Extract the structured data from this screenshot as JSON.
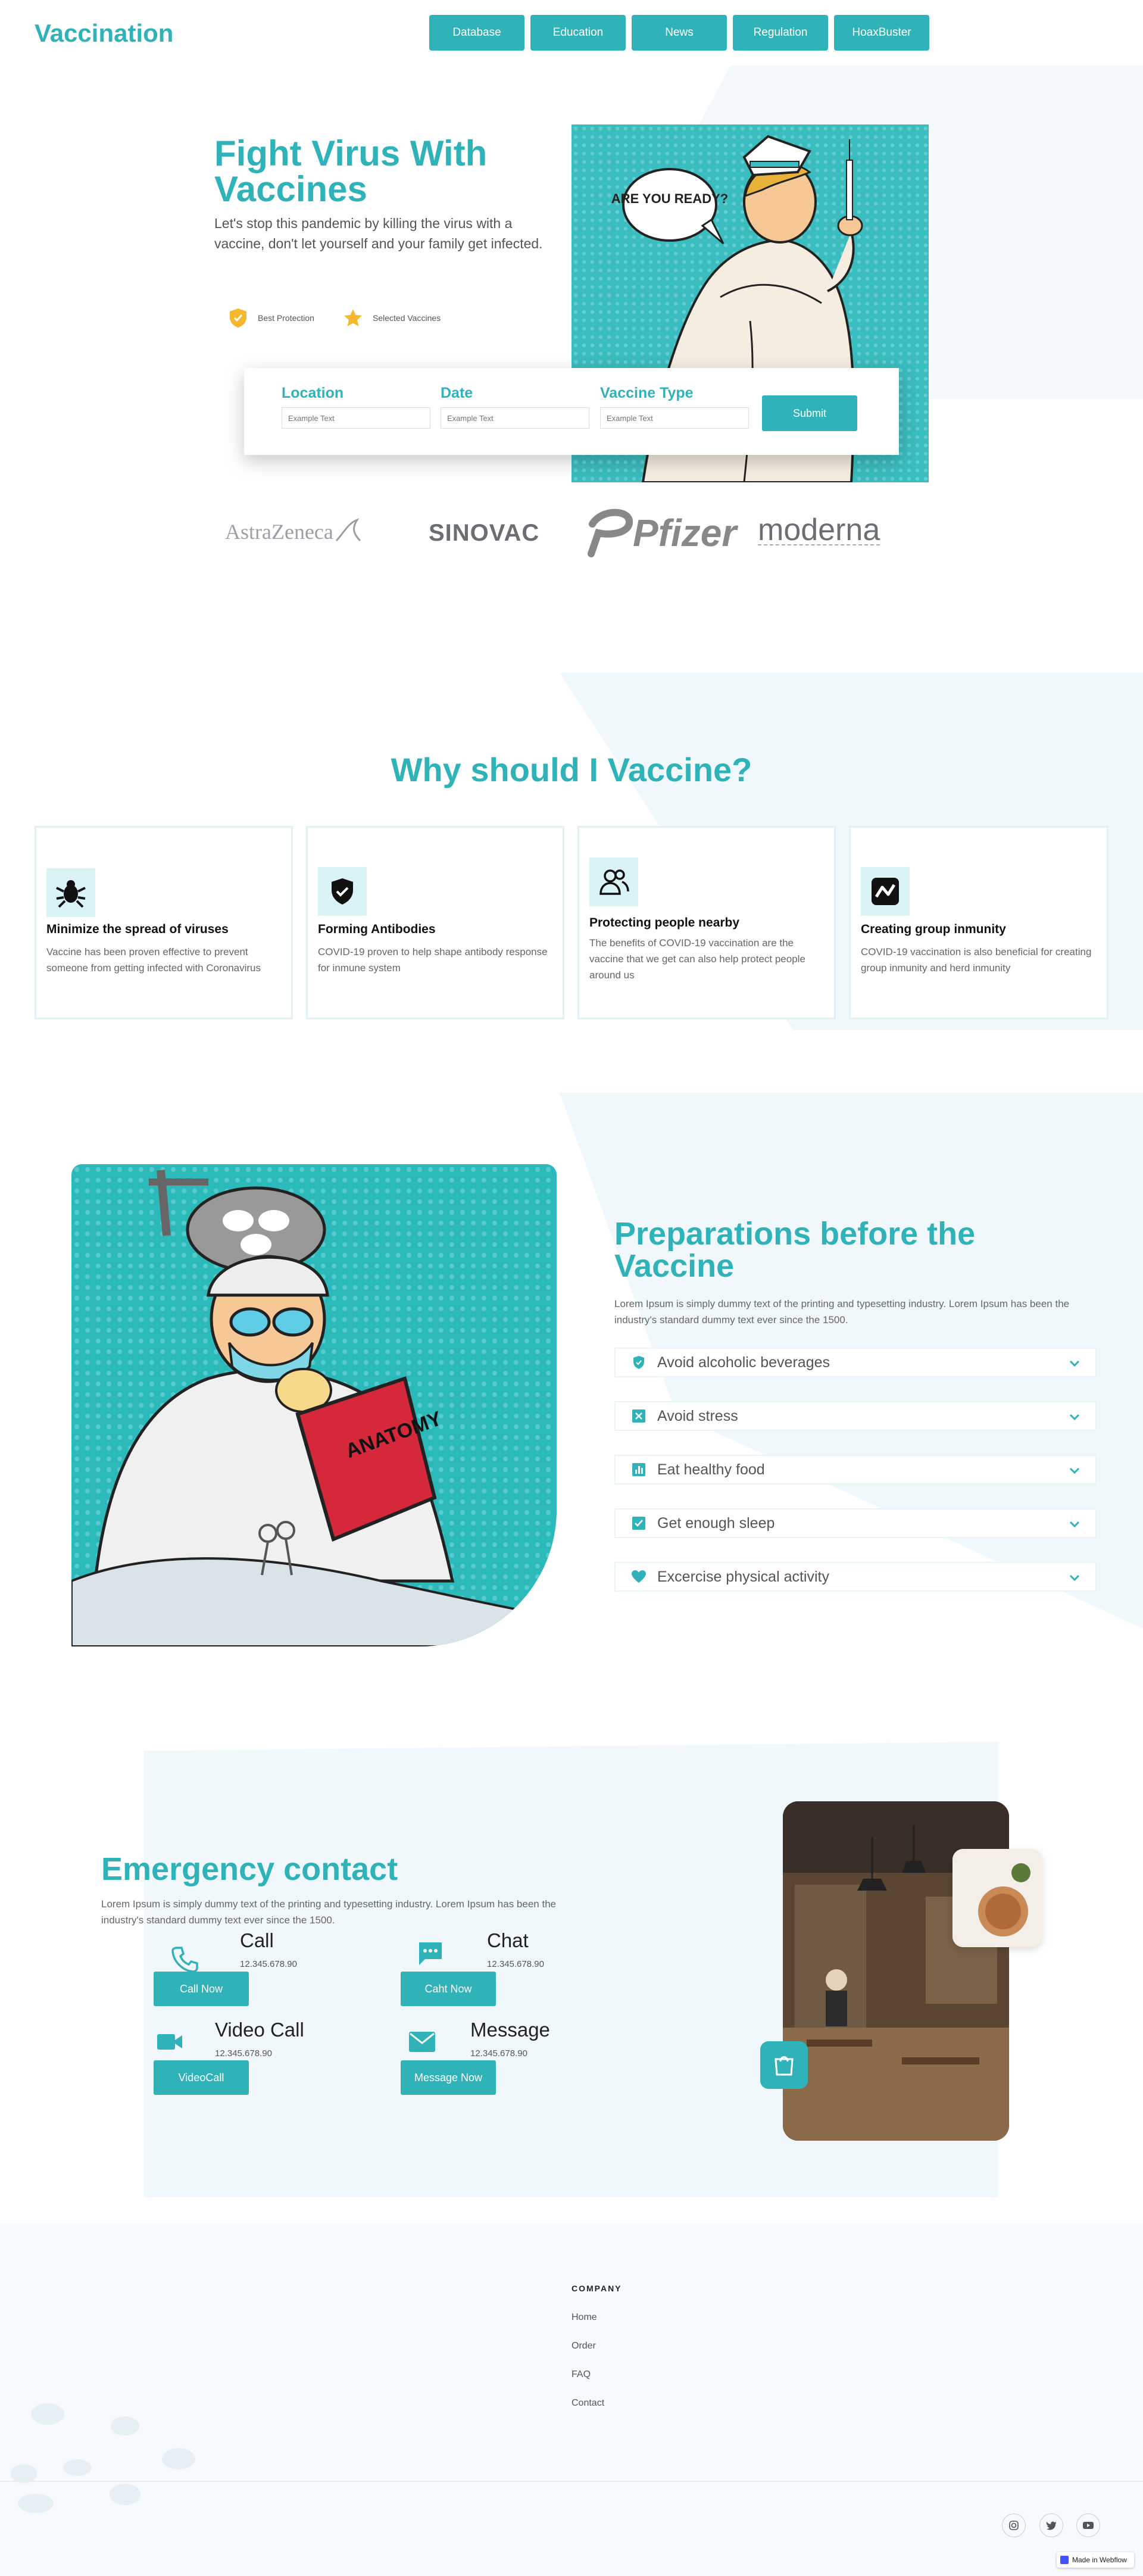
{
  "header": {
    "logo": "Vaccination",
    "nav": [
      "Database",
      "Education",
      "News",
      "Regulation",
      "HoaxBuster"
    ]
  },
  "hero": {
    "title": "Fight Virus With Vaccines",
    "subtitle": "Let's stop this pandemic by killing the virus with a vaccine, don't let yourself and your family get infected.",
    "badges": [
      {
        "icon": "shield-icon",
        "label": "Best Protection"
      },
      {
        "icon": "star-icon",
        "label": "Selected Vaccines"
      }
    ],
    "image_icon": "nurse-illustration",
    "speech_bubble": "ARE YOU READY?"
  },
  "search_form": {
    "fields": [
      {
        "label": "Location",
        "placeholder": "Example Text"
      },
      {
        "label": "Date",
        "placeholder": "Example Text"
      },
      {
        "label": "Vaccine Type",
        "placeholder": "Example Text"
      }
    ],
    "submit": "Submit"
  },
  "brands": [
    "AstraZeneca",
    "SINOVAC",
    "Pfizer",
    "moderna"
  ],
  "why": {
    "title": "Why should I Vaccine?",
    "cards": [
      {
        "icon": "virus-icon",
        "title": "Minimize the spread of viruses",
        "text": "Vaccine has been proven effective to prevent someone from getting infected with Coronavirus"
      },
      {
        "icon": "shield-check-icon",
        "title": "Forming Antibodies",
        "text": "COVID-19 proven to help shape antibody response for inmune system"
      },
      {
        "icon": "people-icon",
        "title": "Protecting people nearby",
        "text": "The benefits of COVID-19 vaccination are the vaccine that we get can also help protect people around us"
      },
      {
        "icon": "activity-icon",
        "title": "Creating group inmunity",
        "text": "COVID-19 vaccination is also beneficial for creating group inmunity and herd inmunity"
      }
    ]
  },
  "prep": {
    "title": "Preparations before the Vaccine",
    "text": "Lorem Ipsum is simply dummy text of the printing and typesetting industry. Lorem Ipsum has been the industry's standard dummy text ever since the 1500.",
    "image_icon": "doctor-reading-illustration",
    "book_title": "ANATOMY",
    "items": [
      {
        "icon": "shield-icon",
        "label": "Avoid alcoholic beverages"
      },
      {
        "icon": "close-box-icon",
        "label": "Avoid stress"
      },
      {
        "icon": "chart-icon",
        "label": "Eat healthy food"
      },
      {
        "icon": "check-box-icon",
        "label": "Get enough sleep"
      },
      {
        "icon": "heart-icon",
        "label": "Excercise physical activity"
      }
    ]
  },
  "emergency": {
    "title": "Emergency contact",
    "text": "Lorem Ipsum is simply dummy text of the printing and typesetting industry. Lorem Ipsum has been the industry's standard dummy text ever since the 1500.",
    "contacts": [
      {
        "icon": "phone-icon",
        "title": "Call",
        "number": "12.345.678.90",
        "button": "Call Now"
      },
      {
        "icon": "chat-icon",
        "title": "Chat",
        "number": "12.345.678.90",
        "button": "Caht Now"
      },
      {
        "icon": "video-icon",
        "title": "Video Call",
        "number": "12.345.678.90",
        "button": "VideoCall"
      },
      {
        "icon": "mail-icon",
        "title": "Message",
        "number": "12.345.678.90",
        "button": "Message Now"
      }
    ],
    "image_icon": "cafe-photo"
  },
  "footer": {
    "heading": "COMPANY",
    "links": [
      "Home",
      "Order",
      "FAQ",
      "Contact"
    ],
    "social": [
      "instagram-icon",
      "twitter-icon",
      "youtube-icon"
    ],
    "badge": "Made in Webflow"
  },
  "colors": {
    "accent": "#2fb2b8",
    "light": "#f1f8fb",
    "icon_bg": "#d9f3f6",
    "star": "#f5b82e"
  }
}
